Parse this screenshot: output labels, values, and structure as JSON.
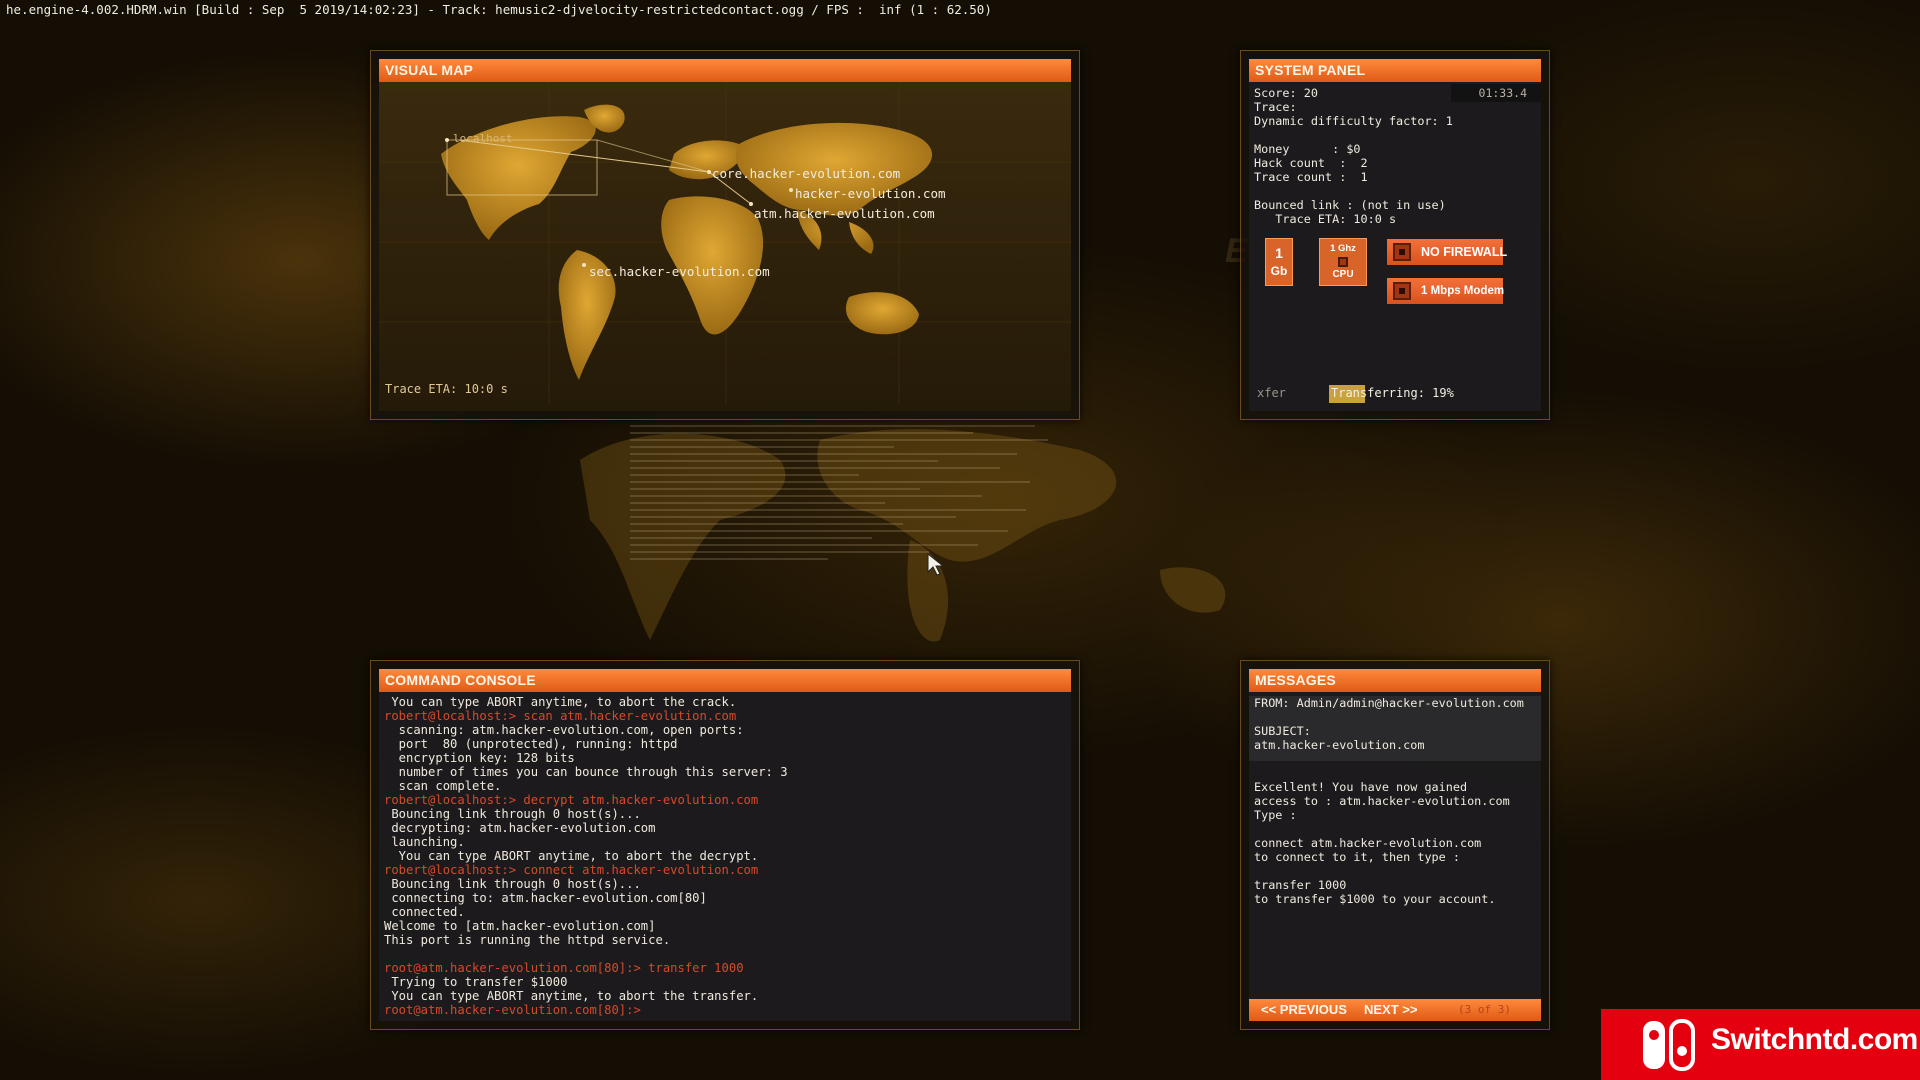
{
  "engine_bar": "he.engine-4.002.HDRM.win [Build : Sep  5 2019/14:02:23] - Track: hemusic2-djvelocity-restrictedcontact.ogg / FPS :  inf (1 : 62.50)",
  "visual_map": {
    "title": "VISUAL MAP",
    "localhost_label": "localhost",
    "hosts": [
      "core.hacker-evolution.com",
      "hacker-evolution.com",
      "atm.hacker-evolution.com",
      "sec.hacker-evolution.com"
    ],
    "trace_eta": "Trace ETA: 10:0 s"
  },
  "system_panel": {
    "title": "SYSTEM PANEL",
    "timer": "01:33.4",
    "lines": [
      "Score: 20",
      "Trace:",
      "Dynamic difficulty factor: 1",
      "",
      "Money      : $0",
      "Hack count  :  2",
      "Trace count :  1",
      "",
      "Bounced link : (not in use)",
      "   Trace ETA: 10:0 s"
    ],
    "memory": {
      "top": "1",
      "bottom": "Gb"
    },
    "cpu": {
      "top": "1 Ghz",
      "bottom": "CPU"
    },
    "firewall": "NO FIREWALL",
    "modem": "1 Mbps Modem",
    "xfer_label": "xfer",
    "transfer_status": "Transferring: 19%",
    "transfer_progress": 0.19
  },
  "command_console": {
    "title": "COMMAND CONSOLE",
    "lines": [
      {
        "t": "out",
        "text": " You can type ABORT anytime, to abort the crack."
      },
      {
        "t": "cmd",
        "text": "robert@localhost:> scan atm.hacker-evolution.com"
      },
      {
        "t": "out",
        "text": "  scanning: atm.hacker-evolution.com, open ports:"
      },
      {
        "t": "out",
        "text": "  port  80 (unprotected), running: httpd"
      },
      {
        "t": "out",
        "text": "  encryption key: 128 bits"
      },
      {
        "t": "out",
        "text": "  number of times you can bounce through this server: 3"
      },
      {
        "t": "out",
        "text": "  scan complete."
      },
      {
        "t": "cmd",
        "text": "robert@localhost:> decrypt atm.hacker-evolution.com"
      },
      {
        "t": "out",
        "text": " Bouncing link through 0 host(s)..."
      },
      {
        "t": "out",
        "text": " decrypting: atm.hacker-evolution.com"
      },
      {
        "t": "out",
        "text": " launching."
      },
      {
        "t": "out",
        "text": "  You can type ABORT anytime, to abort the decrypt."
      },
      {
        "t": "cmd",
        "text": "robert@localhost:> connect atm.hacker-evolution.com"
      },
      {
        "t": "out",
        "text": " Bouncing link through 0 host(s)..."
      },
      {
        "t": "out",
        "text": " connecting to: atm.hacker-evolution.com[80]"
      },
      {
        "t": "out",
        "text": " connected."
      },
      {
        "t": "out",
        "text": "Welcome to [atm.hacker-evolution.com]"
      },
      {
        "t": "out",
        "text": "This port is running the httpd service."
      },
      {
        "t": "out",
        "text": ""
      },
      {
        "t": "cmd",
        "text": "root@atm.hacker-evolution.com[80]:> transfer 1000"
      },
      {
        "t": "out",
        "text": " Trying to transfer $1000"
      },
      {
        "t": "out",
        "text": " You can type ABORT anytime, to abort the transfer."
      },
      {
        "t": "cmd",
        "text": "root@atm.hacker-evolution.com[80]:>"
      }
    ]
  },
  "messages": {
    "title": "MESSAGES",
    "header_lines": [
      "FROM: Admin/admin@hacker-evolution.com",
      "",
      "SUBJECT:",
      "atm.hacker-evolution.com"
    ],
    "body_lines": [
      "Excellent! You have now gained",
      "access to : atm.hacker-evolution.com",
      "Type :",
      "",
      "connect atm.hacker-evolution.com",
      "to connect to it, then type :",
      "",
      "transfer 1000",
      "to transfer $1000 to your account."
    ],
    "prev_label": "<< PREVIOUS",
    "next_label": "NEXT >>",
    "count": "(3 of 3)"
  },
  "badge": {
    "text": "Switchntd.com",
    "color": "#e4000f"
  }
}
